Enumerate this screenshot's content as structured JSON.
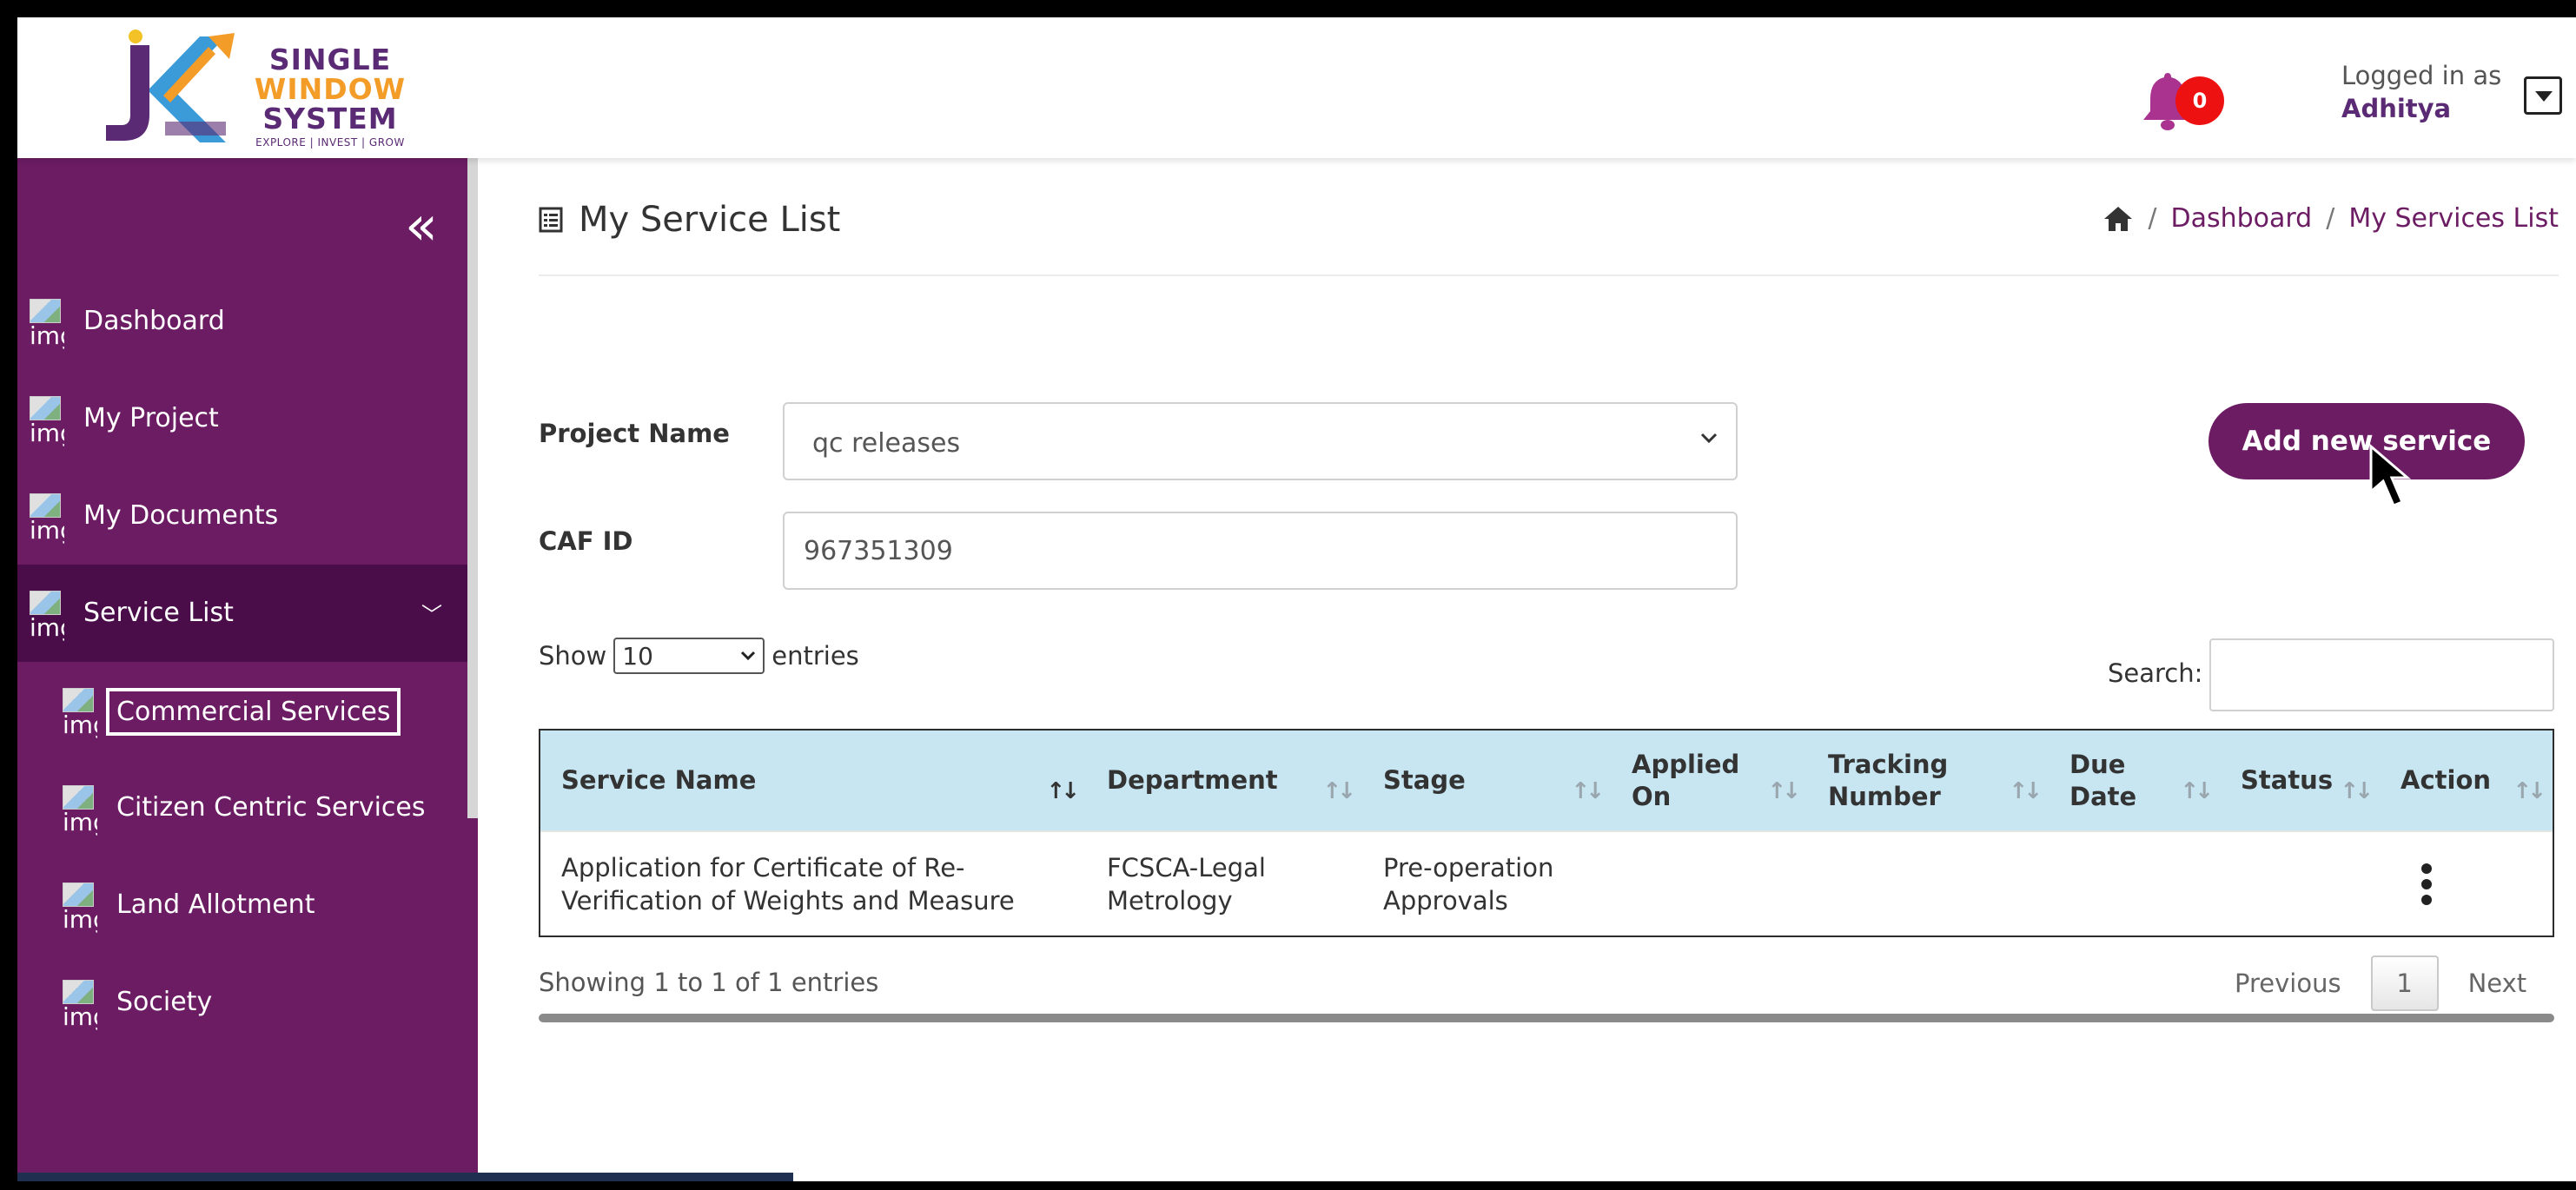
{
  "header": {
    "logo": {
      "line1": "SINGLE",
      "line2": "WINDOW",
      "line3": "SYSTEM",
      "tagline": "EXPLORE | INVEST | GROW"
    },
    "notifications": {
      "count": "0",
      "icon": "bell-icon"
    },
    "user": {
      "label": "Logged in as",
      "name": "Adhitya"
    }
  },
  "sidebar": {
    "collapse_icon": "«",
    "img_alt": "img",
    "items": [
      {
        "label": "Dashboard"
      },
      {
        "label": "My Project"
      },
      {
        "label": "My Documents"
      },
      {
        "label": "Service List"
      }
    ],
    "sub_items": [
      {
        "label": "Commercial Services"
      },
      {
        "label": "Citizen Centric Services"
      },
      {
        "label": "Land Allotment"
      },
      {
        "label": "Society"
      }
    ]
  },
  "main": {
    "title": "My Service List",
    "breadcrumb": {
      "sep": "/",
      "dashboard": "Dashboard",
      "current": "My Services List"
    },
    "form": {
      "project_label": "Project Name",
      "project_value": "qc releases",
      "caf_label": "CAF ID",
      "caf_value": "967351309",
      "add_button": "Add new service"
    },
    "table_controls": {
      "show_label": "Show",
      "entries_value": "10",
      "entries_label": "entries",
      "search_label": "Search:"
    },
    "table": {
      "columns": [
        "Service Name",
        "Department",
        "Stage",
        "Applied On",
        "Tracking Number",
        "Due Date",
        "Status",
        "Action"
      ],
      "rows": [
        {
          "service_name": "Application for Certificate of Re-Verification of Weights and Measure",
          "department": "FCSCA-Legal Metrology",
          "stage": "Pre-operation Approvals",
          "applied_on": "",
          "tracking_number": "",
          "due_date": "",
          "status": ""
        }
      ]
    },
    "footer": {
      "showing": "Showing 1 to 1 of 1 entries",
      "previous": "Previous",
      "page": "1",
      "next": "Next"
    }
  },
  "colors": {
    "brand_purple": "#6b1c63",
    "sidebar_active": "#4a0d4a",
    "table_header": "#c7e6f2",
    "badge_red": "#ee1111",
    "logo_orange": "#f39c27"
  }
}
